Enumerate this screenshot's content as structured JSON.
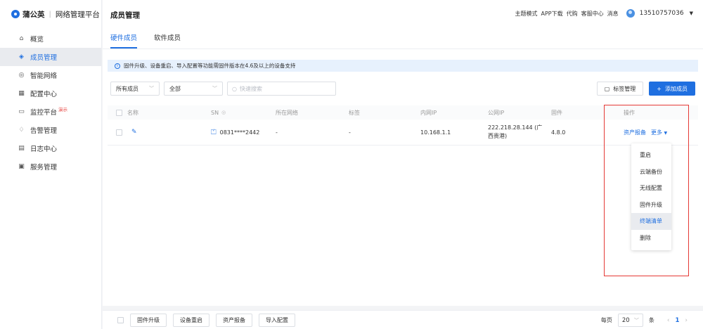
{
  "brand": {
    "name": "蒲公英",
    "separator": "|",
    "subtitle": "网络管理平台"
  },
  "sidebar": {
    "items": [
      {
        "label": "概览",
        "icon": "home-icon"
      },
      {
        "label": "成员管理",
        "icon": "layers-icon",
        "active": true
      },
      {
        "label": "智能网络",
        "icon": "network-icon"
      },
      {
        "label": "配置中心",
        "icon": "grid-icon"
      },
      {
        "label": "监控平台",
        "icon": "monitor-icon",
        "badge": "演示"
      },
      {
        "label": "告警管理",
        "icon": "bell-icon"
      },
      {
        "label": "日志中心",
        "icon": "log-icon"
      },
      {
        "label": "服务管理",
        "icon": "service-icon"
      }
    ]
  },
  "header": {
    "title": "成员管理",
    "links": [
      "主题模式",
      "APP下载",
      "代购",
      "客服中心",
      "消息"
    ],
    "phone": "13510757036"
  },
  "tabs": [
    {
      "label": "硬件成员",
      "active": true
    },
    {
      "label": "软件成员"
    }
  ],
  "notice": "固件升级、设备重启、导入配置等功能需固件版本在4.6及以上的设备支持",
  "filters": {
    "member_select": "所有成员",
    "status_select": "全部",
    "search_placeholder": "快速搜索"
  },
  "actions": {
    "tag_manage": "标签管理",
    "add_member": "添加成员"
  },
  "table": {
    "columns": [
      "名称",
      "SN",
      "所在网络",
      "标签",
      "内网IP",
      "公网IP",
      "固件",
      "操作"
    ],
    "rows": [
      {
        "name": "",
        "sn": "0831****2442",
        "network": "-",
        "tag": "-",
        "lan_ip": "10.168.1.1",
        "wan_ip": "222.218.28.144 (广西贵港)",
        "firmware": "4.8.0",
        "op_report": "资产报备",
        "op_more": "更多"
      }
    ]
  },
  "more_menu": [
    "重启",
    "云端备份",
    "无线配置",
    "固件升级",
    "终端清单",
    "删除"
  ],
  "footer": {
    "buttons": [
      "固件升级",
      "设备重启",
      "资产报备",
      "导入配置"
    ],
    "per_page_label": "每页",
    "per_page": "20",
    "unit": "条",
    "current_page": "1"
  },
  "colors": {
    "accent": "#1f6fe0",
    "highlight": "#e53935"
  }
}
